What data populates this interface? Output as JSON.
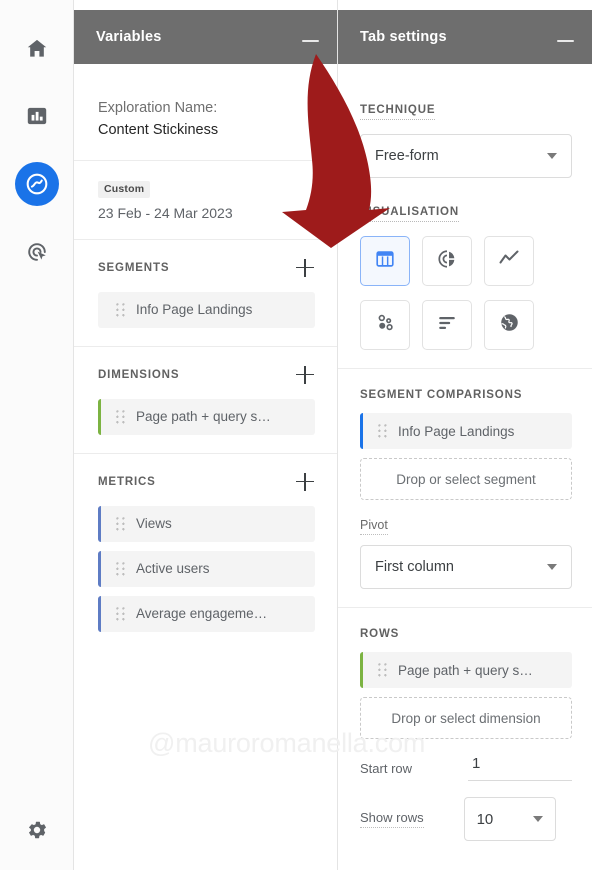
{
  "nav": {
    "items": [
      {
        "name": "home",
        "icon": "home-icon",
        "active": false
      },
      {
        "name": "reports",
        "icon": "bar-chart-icon",
        "active": false
      },
      {
        "name": "explore",
        "icon": "explore-icon",
        "active": true
      },
      {
        "name": "advertising",
        "icon": "target-cursor-icon",
        "active": false
      }
    ],
    "settings": {
      "name": "settings",
      "icon": "gear-icon"
    }
  },
  "variables": {
    "header_title": "Variables",
    "minimize_label": "—",
    "exploration": {
      "label": "Exploration Name:",
      "value": "Content Stickiness"
    },
    "date": {
      "badge": "Custom",
      "range": "23 Feb - 24 Mar 2023"
    },
    "segments": {
      "title": "SEGMENTS",
      "add_label": "+",
      "items": [
        {
          "label": "Info Page Landings",
          "accent": "none"
        }
      ]
    },
    "dimensions": {
      "title": "DIMENSIONS",
      "add_label": "+",
      "items": [
        {
          "label": "Page path + query s…",
          "accent": "green"
        }
      ]
    },
    "metrics": {
      "title": "METRICS",
      "add_label": "+",
      "items": [
        {
          "label": "Views",
          "accent": "blue"
        },
        {
          "label": "Active users",
          "accent": "blue"
        },
        {
          "label": "Average engageme…",
          "accent": "blue"
        }
      ]
    }
  },
  "tab_settings": {
    "header_title": "Tab settings",
    "minimize_label": "—",
    "technique": {
      "title": "TECHNIQUE",
      "value": "Free-form"
    },
    "visualisation": {
      "title": "VISUALISATION",
      "options": [
        {
          "name": "table-chart-icon",
          "label": "Free-form table",
          "selected": true
        },
        {
          "name": "donut-chart-icon",
          "label": "Donut chart",
          "selected": false
        },
        {
          "name": "line-chart-icon",
          "label": "Line chart",
          "selected": false
        },
        {
          "name": "scatter-chart-icon",
          "label": "Scatter plot",
          "selected": false
        },
        {
          "name": "bar-chart-icon",
          "label": "Bar chart",
          "selected": false
        },
        {
          "name": "geo-map-icon",
          "label": "Geo map",
          "selected": false
        }
      ]
    },
    "segment_comparisons": {
      "title": "SEGMENT COMPARISONS",
      "items": [
        {
          "label": "Info Page Landings",
          "accent": "dblue"
        }
      ],
      "dropzone": "Drop or select segment"
    },
    "pivot": {
      "label": "Pivot",
      "value": "First column"
    },
    "rows": {
      "title": "ROWS",
      "items": [
        {
          "label": "Page path + query s…",
          "accent": "green"
        }
      ],
      "dropzone": "Drop or select dimension",
      "start_row": {
        "label": "Start row",
        "value": "1"
      },
      "show_rows": {
        "label": "Show rows",
        "value": "10"
      }
    }
  },
  "overlay": {
    "watermark": "@mauroromanella.com",
    "arrow_color": "#9e1b1b"
  },
  "colors": {
    "header_gray": "#6e6e6e",
    "accent_blue": "#1a73e8",
    "accent_green": "#7cb342",
    "metric_blue": "#5e7cc4",
    "chip_bg": "#f4f4f4"
  }
}
